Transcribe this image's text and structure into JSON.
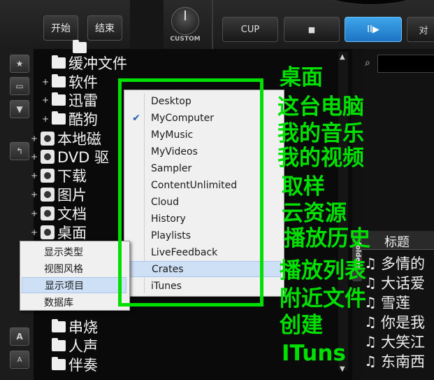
{
  "deck": {
    "start_label": "开始",
    "end_label": "结束",
    "knob_label": "CUSTOM",
    "cup_label": "CUP",
    "stop_glyph": "■",
    "play_glyph": "II▶",
    "partial_label": "对"
  },
  "tree": [
    {
      "label": "缓冲文件",
      "icon": "folder-icon",
      "plus": ""
    },
    {
      "label": "软件",
      "icon": "folder-icon",
      "plus": "+"
    },
    {
      "label": "迅雷",
      "icon": "folder-icon",
      "plus": "+"
    },
    {
      "label": "酷狗",
      "icon": "folder-icon",
      "plus": "+"
    },
    {
      "label": "本地磁",
      "icon": "drive-icon",
      "plus": "+"
    },
    {
      "label": "DVD 驱",
      "icon": "drive-icon",
      "plus": "+"
    },
    {
      "label": "下载",
      "icon": "drive-icon",
      "plus": "+"
    },
    {
      "label": "图片",
      "icon": "drive-icon",
      "plus": "+"
    },
    {
      "label": "文档",
      "icon": "drive-icon",
      "plus": "+"
    },
    {
      "label": "桌面",
      "icon": "drive-icon",
      "plus": "+"
    },
    {
      "label": "串烧",
      "icon": "folder-icon",
      "plus": ""
    },
    {
      "label": "人声",
      "icon": "folder-icon",
      "plus": ""
    },
    {
      "label": "伴奏",
      "icon": "folder-icon",
      "plus": ""
    }
  ],
  "context_menu": {
    "items": [
      {
        "label": "显示类型",
        "selected": false
      },
      {
        "label": "视图风格",
        "selected": false
      },
      {
        "label": "显示项目",
        "selected": true
      },
      {
        "label": "数据库",
        "selected": false
      }
    ]
  },
  "submenu": {
    "items": [
      {
        "label": "Desktop",
        "checked": false,
        "selected": false
      },
      {
        "label": "MyComputer",
        "checked": true,
        "selected": false
      },
      {
        "label": "MyMusic",
        "checked": false,
        "selected": false
      },
      {
        "label": "MyVideos",
        "checked": false,
        "selected": false
      },
      {
        "label": "Sampler",
        "checked": false,
        "selected": false
      },
      {
        "label": "ContentUnlimited",
        "checked": false,
        "selected": false
      },
      {
        "label": "Cloud",
        "checked": false,
        "selected": false
      },
      {
        "label": "History",
        "checked": false,
        "selected": false
      },
      {
        "label": "Playlists",
        "checked": false,
        "selected": false
      },
      {
        "label": "LiveFeedback",
        "checked": false,
        "selected": false
      },
      {
        "label": "Crates",
        "checked": false,
        "selected": true
      },
      {
        "label": "iTunes",
        "checked": false,
        "selected": false
      }
    ]
  },
  "annotations": [
    "桌面",
    "这台电脑",
    "我的音乐",
    "我的视频",
    "取样",
    "云资源",
    "播放历史",
    "播放列表",
    "附近文件",
    "创建",
    "ITuns"
  ],
  "folders_tab": "folders",
  "track_list": {
    "header": "标题",
    "rows": [
      "多情的",
      "大话爱",
      "雪莲",
      "你是我",
      "大笑江",
      "东南西"
    ]
  },
  "tools": [
    {
      "icon": "star-icon",
      "glyph": "★"
    },
    {
      "icon": "window-icon",
      "glyph": "▭"
    },
    {
      "icon": "filter-icon",
      "glyph": "▼"
    },
    {
      "icon": "back-arrow-icon",
      "glyph": "↰"
    },
    {
      "icon": "font-large-icon",
      "glyph": "A"
    },
    {
      "icon": "font-small-icon",
      "glyph": "A"
    }
  ],
  "colors": {
    "annotation": "#00e000",
    "highlight": "#2b8de0",
    "menu_selected": "#cde0f5"
  }
}
